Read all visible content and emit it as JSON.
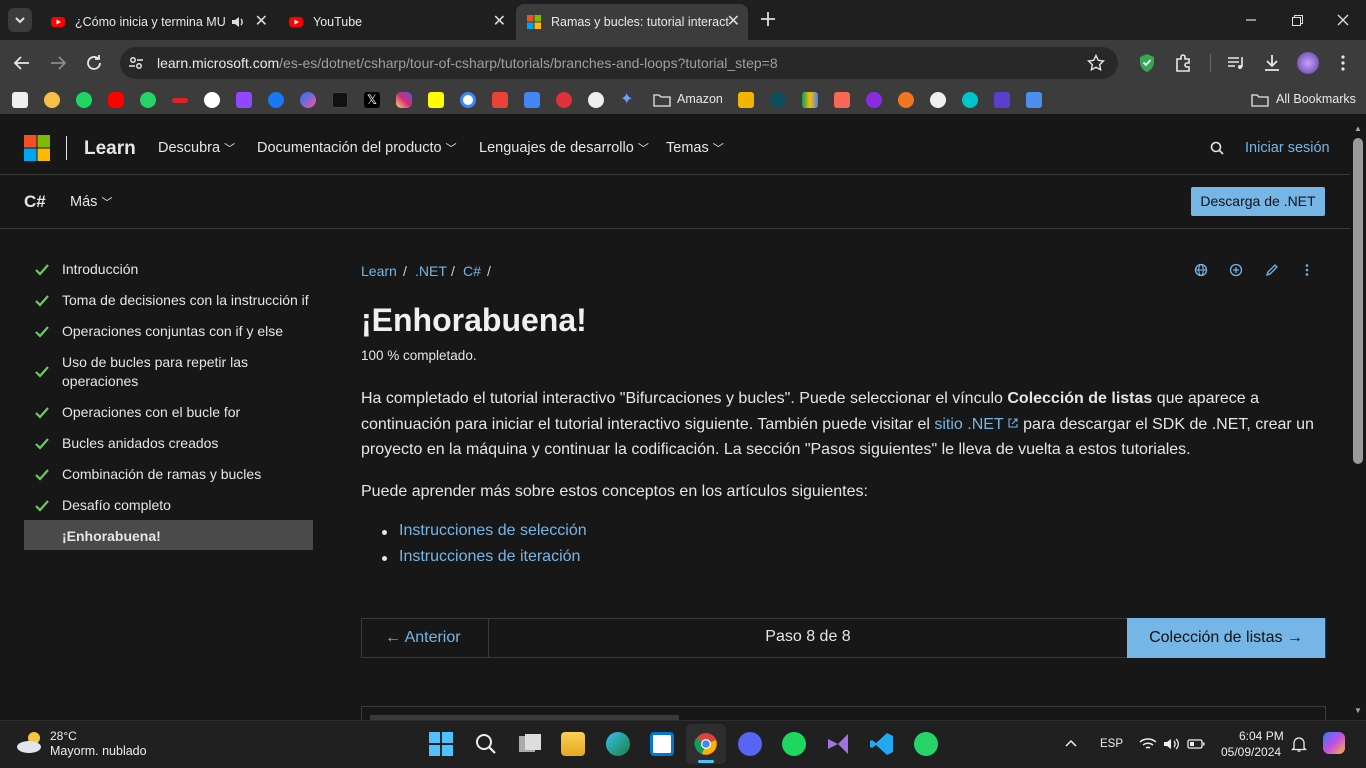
{
  "tabs": [
    {
      "title": "¿Cómo inicia y termina MU",
      "audio": true
    },
    {
      "title": "YouTube"
    },
    {
      "title": "Ramas y bucles: tutorial interact"
    }
  ],
  "address": {
    "host": "learn.microsoft.com",
    "path": "/es-es/dotnet/csharp/tour-of-csharp/tutorials/branches-and-loops?tutorial_step=8"
  },
  "bookmarks": {
    "amazon": "Amazon",
    "all": "All Bookmarks"
  },
  "site": {
    "brand": "Learn",
    "nav": [
      "Descubra",
      "Documentación del producto",
      "Lenguajes de desarrollo",
      "Temas"
    ],
    "signin": "Iniciar sesión",
    "product": "C#",
    "more": "Más",
    "download": "Descarga de .NET"
  },
  "sidebar": {
    "items": [
      {
        "label": "Introducción",
        "done": true
      },
      {
        "label": "Toma de decisiones con la instrucción if",
        "done": true
      },
      {
        "label": "Operaciones conjuntas con if y else",
        "done": true
      },
      {
        "label": "Uso de bucles para repetir las operaciones",
        "done": true
      },
      {
        "label": "Operaciones con el bucle for",
        "done": true
      },
      {
        "label": "Bucles anidados creados",
        "done": true
      },
      {
        "label": "Combinación de ramas y bucles",
        "done": true
      },
      {
        "label": "Desafío completo",
        "done": true
      },
      {
        "label": "¡Enhorabuena!",
        "done": false,
        "selected": true
      }
    ]
  },
  "breadcrumb": [
    "Learn",
    ".NET",
    "C#"
  ],
  "content": {
    "title": "¡Enhorabuena!",
    "progress": "100 % completado.",
    "para1_a": "Ha completado el tutorial interactivo \"Bifurcaciones y bucles\". Puede seleccionar el vínculo ",
    "para1_bold": "Colección de listas",
    "para1_b": " que aparece a continuación para iniciar el tutorial interactivo siguiente. También puede visitar el ",
    "para1_link": "sitio .NET",
    "para1_c": " para descargar el SDK de .NET, crear un proyecto en la máquina y continuar la codificación. La sección \"Pasos siguientes\" le lleva de vuelta a estos tutoriales.",
    "para2": "Puede aprender más sobre estos conceptos en los artículos siguientes:",
    "links": [
      "Instrucciones de selección",
      "Instrucciones de iteración"
    ]
  },
  "pager": {
    "prev": "Anterior",
    "step": "Paso 8 de 8",
    "next": "Colección de listas"
  },
  "taskbar": {
    "weather_temp": "28°C",
    "weather_desc": "Mayorm. nublado",
    "lang": "ESP",
    "time": "6:04 PM",
    "date": "05/09/2024"
  },
  "colors": {
    "accent": "#75b6e7",
    "check": "#6ccb5f"
  }
}
